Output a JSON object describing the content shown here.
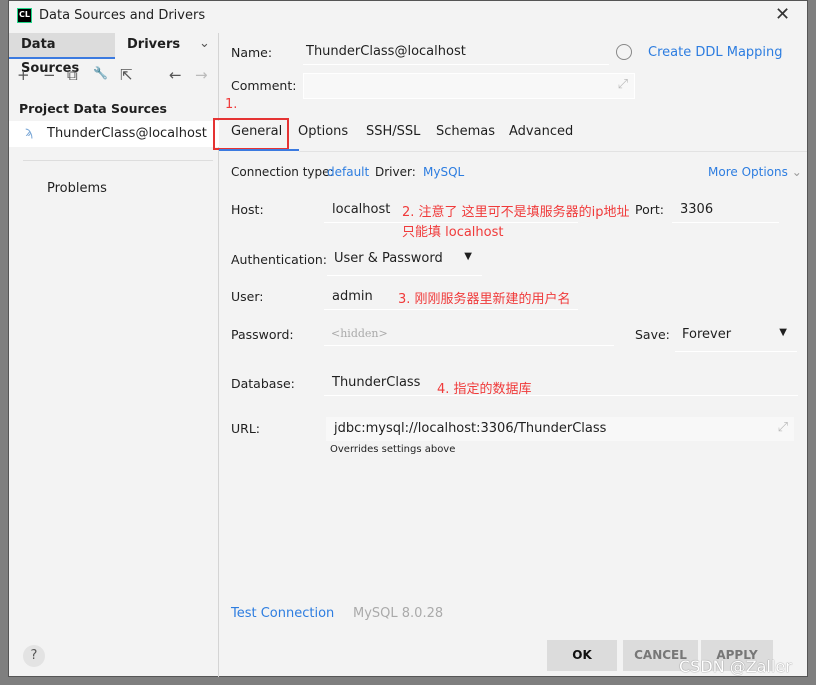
{
  "window": {
    "title": "Data Sources and Drivers",
    "logo": "CL",
    "close": "✕"
  },
  "left": {
    "tabs": [
      "Data Sources",
      "Drivers"
    ],
    "section": "Project Data Sources",
    "items": [
      {
        "label": "ThunderClass@localhost",
        "icon": "mysql-dolphin-icon"
      }
    ],
    "problems": "Problems",
    "toolbar": [
      "+",
      "−",
      "⧉",
      "🔧",
      "⇱",
      "←",
      "→"
    ]
  },
  "form": {
    "name_label": "Name:",
    "name": "ThunderClass@localhost",
    "ddl": "Create DDL Mapping",
    "comment_label": "Comment:",
    "comment": "",
    "tabs": [
      "General",
      "Options",
      "SSH/SSL",
      "Schemas",
      "Advanced"
    ],
    "active_tab": "General",
    "conn_type_label": "Connection type:",
    "conn_type": "default",
    "driver_label": "Driver:",
    "driver": "MySQL",
    "more": "More Options",
    "host_label": "Host:",
    "host": "localhost",
    "port_label": "Port:",
    "port": "3306",
    "auth_label": "Authentication:",
    "auth": "User & Password",
    "user_label": "User:",
    "user": "admin",
    "password_label": "Password:",
    "password_placeholder": "<hidden>",
    "save_label": "Save:",
    "save": "Forever",
    "db_label": "Database:",
    "db": "ThunderClass",
    "url_label": "URL:",
    "url": "jdbc:mysql://localhost:3306/ThunderClass",
    "url_hint": "Overrides settings above"
  },
  "annotations": {
    "a1": "1.",
    "a2_line1": "2. 注意了 这里可不是填服务器的ip地址",
    "a2_line2": "只能填 localhost",
    "a3": "3. 刚刚服务器里新建的用户名",
    "a4": "4. 指定的数据库"
  },
  "footer": {
    "test": "Test Connection",
    "version": "MySQL 8.0.28",
    "ok": "OK",
    "cancel": "CANCEL",
    "apply": "APPLY",
    "help": "?",
    "watermark": "CSDN @Zaller"
  },
  "colors": {
    "accent": "#2d7de0",
    "annotation": "#f03a3a"
  }
}
